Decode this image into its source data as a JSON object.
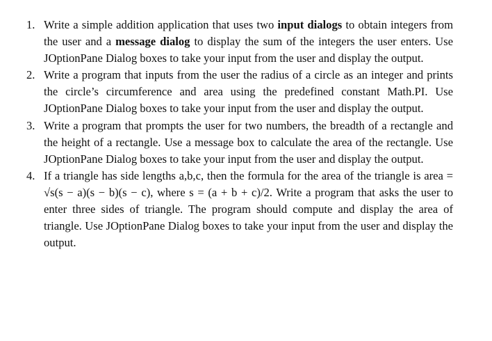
{
  "items": [
    {
      "num": "1.",
      "t1": "Write a simple addition application that uses two ",
      "b1": "input dialogs",
      "t2": " to obtain integers from the user and a ",
      "b2": "message dialog",
      "t3": " to display the sum of the integers the user enters. Use JOptionPane Dialog boxes to take your input from the user and display the output."
    },
    {
      "num": "2.",
      "text": "Write a program that inputs from the user the radius of a circle as an integer and prints the circle’s circumference and area using the predefined constant Math.PI. Use JOptionPane Dialog boxes to take your input from the user and display the output."
    },
    {
      "num": "3.",
      "text": "Write a program that prompts the user for two numbers, the breadth of a rectangle and the height of a rectangle. Use a message box to calculate the area of the rectangle. Use JOptionPane Dialog boxes to take your input from the user and display the output."
    },
    {
      "num": "4.",
      "text": "If a triangle has side lengths a,b,c, then the formula for the area of the triangle is area = √s(s − a)(s − b)(s − c), where s = (a + b + c)/2. Write a program that asks the user to enter three sides of triangle. The program should compute and display the area of triangle. Use JOptionPane Dialog boxes to take your input from the user and display the output."
    }
  ]
}
